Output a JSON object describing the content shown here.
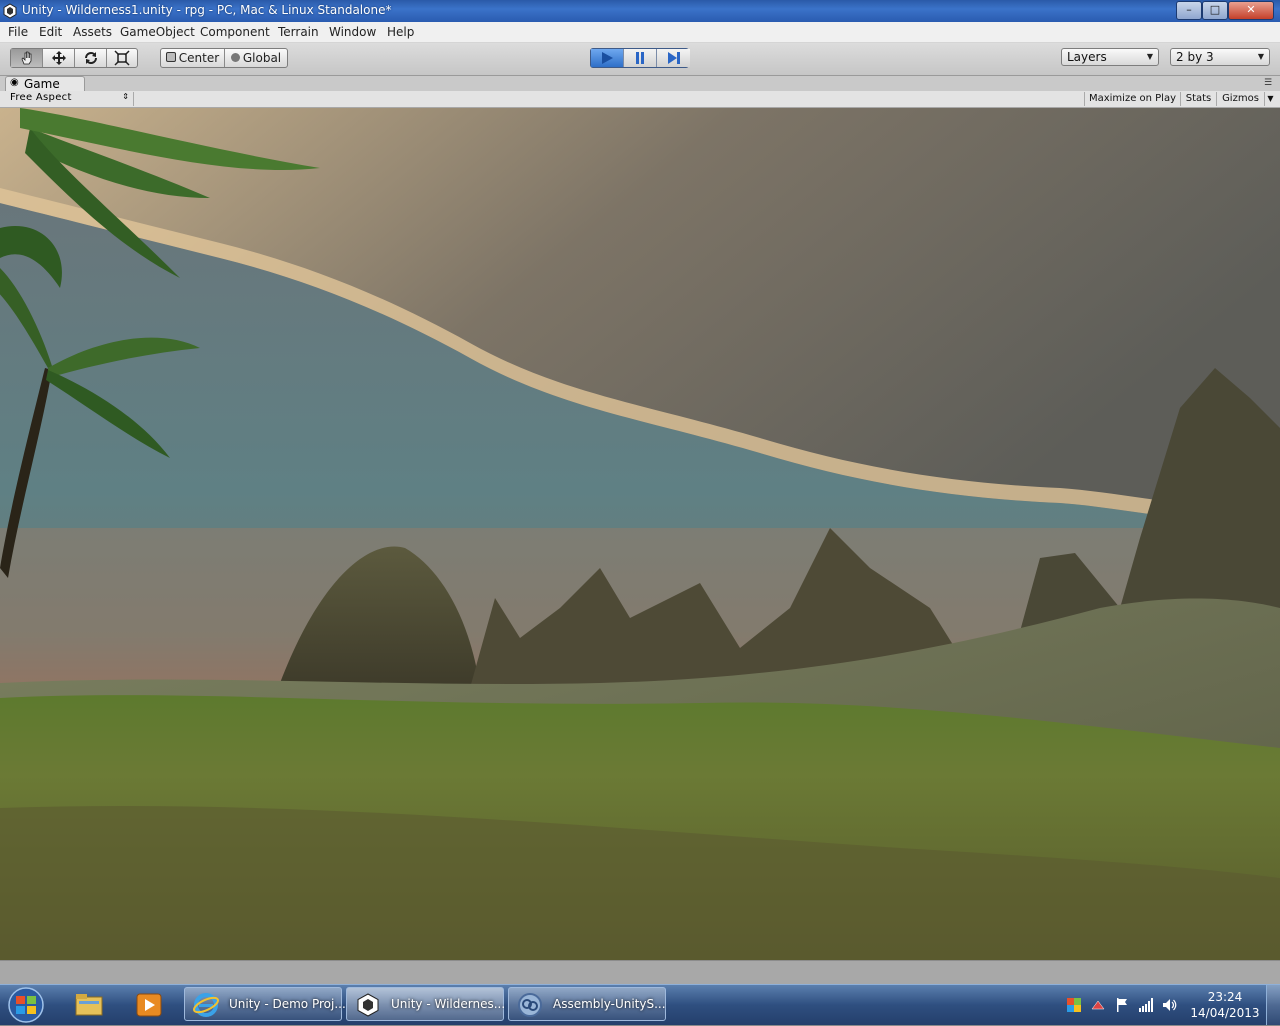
{
  "window": {
    "title": "Unity - Wilderness1.unity - rpg - PC, Mac & Linux Standalone*",
    "minimize_label": "–",
    "maximize_label": "□",
    "close_label": "✕"
  },
  "menu": [
    "File",
    "Edit",
    "Assets",
    "GameObject",
    "Component",
    "Terrain",
    "Window",
    "Help"
  ],
  "toolbar": {
    "pivot_label": "Center",
    "space_label": "Global",
    "layers_label": "Layers",
    "layout_label": "2 by 3"
  },
  "game_view": {
    "tab_label": "Game",
    "aspect_label": "Free Aspect",
    "maximize_on_play_label": "Maximize on Play",
    "stats_label": "Stats",
    "gizmos_label": "Gizmos"
  },
  "taskbar": {
    "tasks": [
      {
        "label": "Unity - Demo Proj..."
      },
      {
        "label": "Unity - Wildernes..."
      },
      {
        "label": "Assembly-UnityS..."
      }
    ],
    "clock_time": "23:24",
    "clock_date": "14/04/2013"
  },
  "colors": {
    "play_active": "#3b7fd6",
    "taskbar": "#2f4f80",
    "titlebar": "#3b73c9"
  }
}
